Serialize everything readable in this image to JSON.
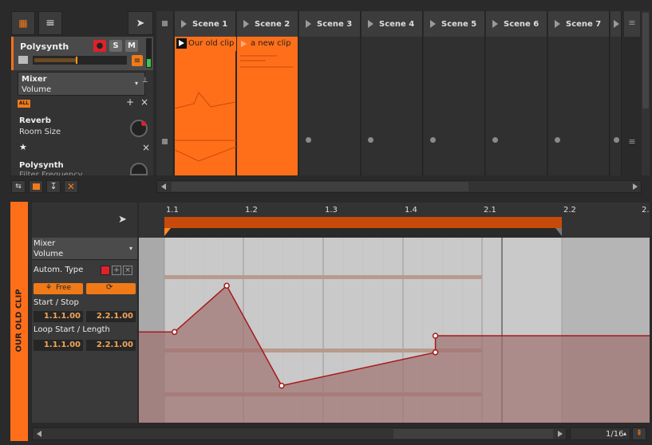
{
  "toolbar_left": {
    "icon_grid": "grid-icon",
    "icon_menu": "menu-icon",
    "icon_pointer": "pointer-icon"
  },
  "track": {
    "name": "Polysynth",
    "record": "●",
    "solo": "S",
    "mute": "M",
    "menu_icon": "equals-icon"
  },
  "mixer": {
    "title": "Mixer",
    "param": "Volume",
    "chain_all": "ALL",
    "plus": "+",
    "close": "×"
  },
  "devices": [
    {
      "name": "Reverb",
      "param": "Room Size"
    },
    {
      "name": "Polysynth",
      "param": "Filter Frequency"
    }
  ],
  "star": "★",
  "scenes": [
    "Scene 1",
    "Scene 2",
    "Scene 3",
    "Scene 4",
    "Scene 5",
    "Scene 6",
    "Scene 7"
  ],
  "clips": [
    {
      "label": "Our old clip"
    },
    {
      "label": "a new clip"
    }
  ],
  "editor": {
    "vertical_tab": "OUR OLD CLIP",
    "ruler_marks": [
      "1.1",
      "1.2",
      "1.3",
      "1.4",
      "2.1",
      "2.2",
      "2."
    ],
    "panel": {
      "mixer": "Mixer",
      "volume": "Volume",
      "autom_type": "Autom. Type",
      "free": "Free",
      "start_stop": "Start / Stop",
      "start_val": "1.1.1.00",
      "stop_val": "2.2.1.00",
      "loop_label": "Loop Start / Length",
      "loop_start": "1.1.1.00",
      "loop_length": "2.2.1.00"
    },
    "grid_value": "1/16"
  },
  "colors": {
    "accent": "#ff6f1a",
    "clip_fill": "#ff6f1a",
    "automation_line": "#a61a1a",
    "automation_fill": "#a07070",
    "editor_bg": "#c9c9c9"
  },
  "chart_data": {
    "type": "line",
    "series": [
      {
        "values": [
          [
            1.0,
            0.49
          ],
          [
            1.13,
            0.49
          ],
          [
            1.32,
            0.74
          ],
          [
            1.52,
            0.2
          ],
          [
            2.08,
            0.38
          ],
          [
            2.08,
            0.47
          ],
          [
            2.86,
            0.47
          ]
        ]
      }
    ],
    "ylim": [
      0,
      1
    ],
    "xlim": [
      1.0,
      2.86
    ]
  }
}
